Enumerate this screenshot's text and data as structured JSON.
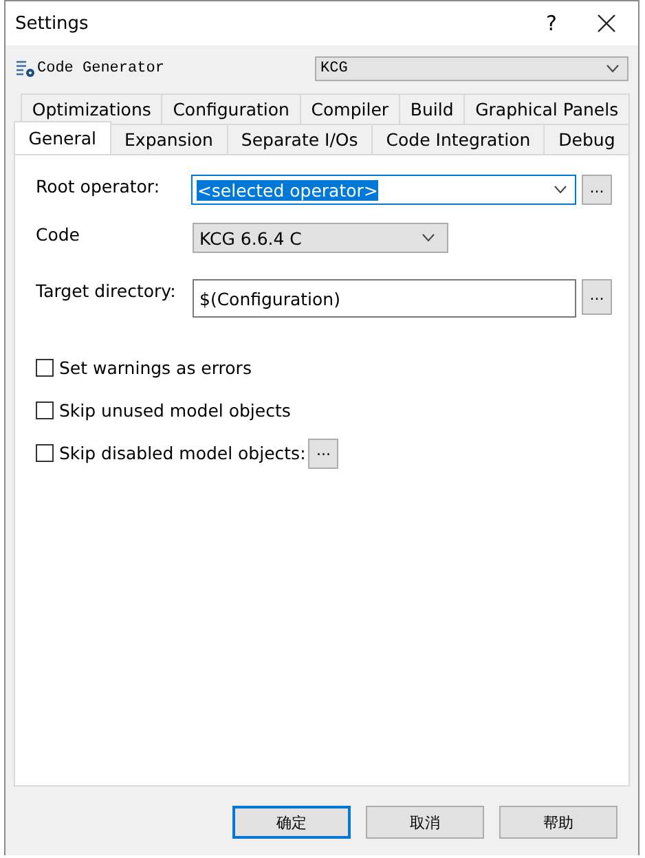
{
  "window": {
    "title": "Settings",
    "help": "?"
  },
  "generator": {
    "label": "Code Generator",
    "value": "KCG"
  },
  "tabs_back": [
    {
      "label": "Optimizations",
      "selected": false
    },
    {
      "label": "Configuration",
      "selected": false
    },
    {
      "label": "Compiler",
      "selected": false
    },
    {
      "label": "Build",
      "selected": false
    },
    {
      "label": "Graphical Panels",
      "selected": false
    }
  ],
  "tabs_front": [
    {
      "label": "General",
      "selected": true
    },
    {
      "label": "Expansion",
      "selected": false
    },
    {
      "label": "Separate I/Os",
      "selected": false
    },
    {
      "label": "Code Integration",
      "selected": false
    },
    {
      "label": "Debug",
      "selected": false
    }
  ],
  "fields": [
    {
      "kind": "combo",
      "label": "Root operator:",
      "value": "<selected operator>",
      "focused": true,
      "browse": "..."
    },
    {
      "kind": "select",
      "label": "Code",
      "value": "KCG 6.6.4 C"
    },
    {
      "kind": "text",
      "label": "Target directory:",
      "value": "$(Configuration)",
      "browse": "..."
    }
  ],
  "checkboxes": [
    {
      "label": "Set warnings as errors",
      "checked": false
    },
    {
      "label": "Skip unused model objects",
      "checked": false
    },
    {
      "label": "Skip disabled model objects:",
      "checked": false,
      "browse": "..."
    }
  ],
  "buttons": [
    {
      "label": "确定",
      "default": true
    },
    {
      "label": "取消",
      "default": false
    },
    {
      "label": "帮助",
      "default": false
    }
  ]
}
